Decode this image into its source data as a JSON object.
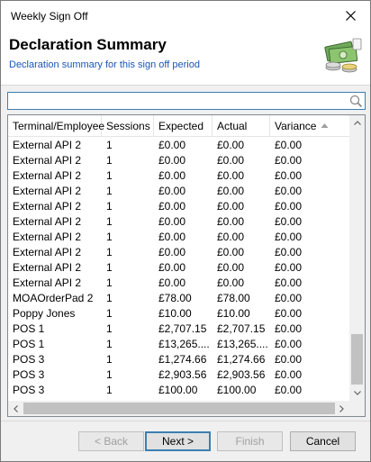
{
  "window": {
    "title": "Weekly Sign Off",
    "close_glyph": "✕"
  },
  "header": {
    "heading": "Declaration Summary",
    "subheading": "Declaration summary for this sign off period",
    "icon": "money-icon"
  },
  "search": {
    "value": "",
    "placeholder": "",
    "icon": "search-icon"
  },
  "table": {
    "columns": [
      "Terminal/Employee",
      "Sessions",
      "Expected",
      "Actual",
      "Variance"
    ],
    "sort_column": "Variance",
    "sort_direction": "ascending",
    "rows": [
      [
        "External API 2",
        "1",
        "£0.00",
        "£0.00",
        "£0.00"
      ],
      [
        "External API 2",
        "1",
        "£0.00",
        "£0.00",
        "£0.00"
      ],
      [
        "External API 2",
        "1",
        "£0.00",
        "£0.00",
        "£0.00"
      ],
      [
        "External API 2",
        "1",
        "£0.00",
        "£0.00",
        "£0.00"
      ],
      [
        "External API 2",
        "1",
        "£0.00",
        "£0.00",
        "£0.00"
      ],
      [
        "External API 2",
        "1",
        "£0.00",
        "£0.00",
        "£0.00"
      ],
      [
        "External API 2",
        "1",
        "£0.00",
        "£0.00",
        "£0.00"
      ],
      [
        "External API 2",
        "1",
        "£0.00",
        "£0.00",
        "£0.00"
      ],
      [
        "External API 2",
        "1",
        "£0.00",
        "£0.00",
        "£0.00"
      ],
      [
        "External API 2",
        "1",
        "£0.00",
        "£0.00",
        "£0.00"
      ],
      [
        "MOAOrderPad 2",
        "1",
        "£78.00",
        "£78.00",
        "£0.00"
      ],
      [
        "Poppy Jones",
        "1",
        "£10.00",
        "£10.00",
        "£0.00"
      ],
      [
        "POS 1",
        "1",
        "£2,707.15",
        "£2,707.15",
        "£0.00"
      ],
      [
        "POS 1",
        "1",
        "£13,265....",
        "£13,265....",
        "£0.00"
      ],
      [
        "POS 3",
        "1",
        "£1,274.66",
        "£1,274.66",
        "£0.00"
      ],
      [
        "POS 3",
        "1",
        "£2,903.56",
        "£2,903.56",
        "£0.00"
      ],
      [
        "POS 3",
        "1",
        "£100.00",
        "£100.00",
        "£0.00"
      ]
    ]
  },
  "buttons": {
    "back": "< Back",
    "next": "Next >",
    "finish": "Finish",
    "cancel": "Cancel"
  }
}
